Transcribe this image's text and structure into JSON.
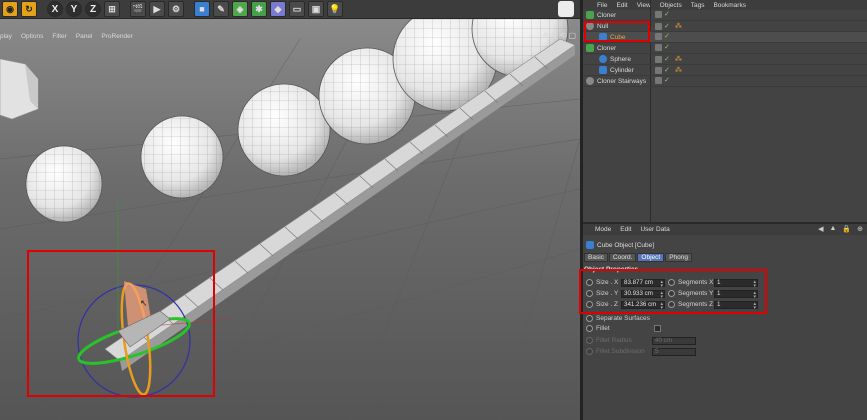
{
  "toolbar": {
    "axes": [
      "X",
      "Y",
      "Z"
    ]
  },
  "viewport_menu": [
    "play",
    "Options",
    "Filter",
    "Panel",
    "ProRender"
  ],
  "object_manager": {
    "menu": [
      "File",
      "Edit",
      "View",
      "Objects",
      "Tags",
      "Bookmarks"
    ],
    "items": [
      {
        "label": "Cloner",
        "kind": "cloner",
        "indent": 0
      },
      {
        "label": "Null",
        "kind": "null",
        "indent": 0
      },
      {
        "label": "Cube",
        "kind": "cube",
        "indent": 1
      },
      {
        "label": "Cloner",
        "kind": "cloner",
        "indent": 0
      },
      {
        "label": "Sphere",
        "kind": "sphere",
        "indent": 1
      },
      {
        "label": "Cylinder",
        "kind": "cylinder",
        "indent": 1
      },
      {
        "label": "Cloner Stairways",
        "kind": "null",
        "indent": 0
      }
    ]
  },
  "attribute_manager": {
    "menu": [
      "Mode",
      "Edit",
      "User Data"
    ],
    "title": "Cube Object [Cube]",
    "tabs": [
      "Basic",
      "Coord.",
      "Object",
      "Phong"
    ],
    "active_tab": "Object",
    "section": "Object Properties",
    "size_x_label": "Size . X",
    "size_x": "83.877 cm",
    "size_y_label": "Size . Y",
    "size_y": "30.933 cm",
    "size_z_label": "Size . Z",
    "size_z": "341.236 cm",
    "seg_x_label": "Segments X",
    "seg_x": "1",
    "seg_y_label": "Segments Y",
    "seg_y": "1",
    "seg_z_label": "Segments Z",
    "seg_z": "1",
    "separate_surfaces": "Separate Surfaces",
    "fillet": "Fillet",
    "fillet_radius_label": "Fillet Radius",
    "fillet_radius": "40 cm",
    "fillet_subdivision_label": "Fillet Subdivision",
    "fillet_subdivision": "5"
  },
  "colors": {
    "highlight": "#e00000",
    "active_tab": "#5674b8",
    "accent": "#e3a21a"
  }
}
